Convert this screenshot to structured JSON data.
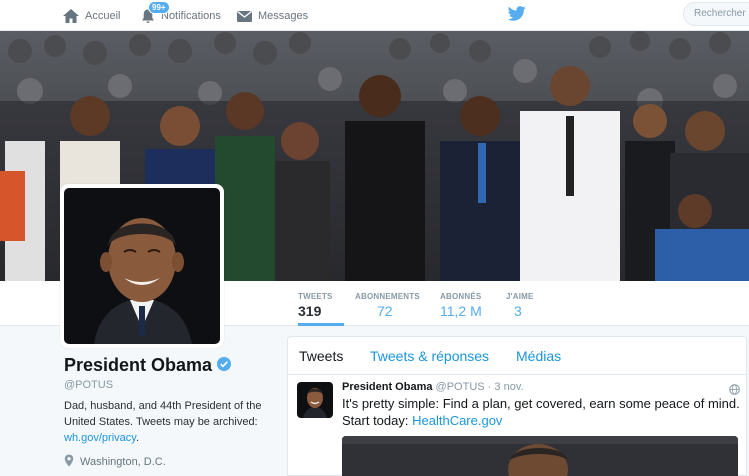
{
  "nav": {
    "home_label": "Accueil",
    "notifications_label": "Notifications",
    "notifications_badge": "99+",
    "messages_label": "Messages",
    "search_placeholder": "Rechercher sur Twitter"
  },
  "stats": [
    {
      "label": "TWEETS",
      "value": "319"
    },
    {
      "label": "ABONNEMENTS",
      "value": "72"
    },
    {
      "label": "ABONNÉS",
      "value": "11,2 M"
    },
    {
      "label": "J'AIME",
      "value": "3"
    }
  ],
  "profile": {
    "name": "President Obama",
    "handle": "@POTUS",
    "bio_text": "Dad, husband, and 44th President of the United States. Tweets may be archived:",
    "bio_link": "wh.gov/privacy",
    "bio_end": ".",
    "location": "Washington, D.C.",
    "verified": true
  },
  "timeline": {
    "tabs": [
      "Tweets",
      "Tweets & réponses",
      "Médias"
    ],
    "active_tab": "Tweets",
    "tweet": {
      "author": "President Obama",
      "handle": "@POTUS",
      "separator": "·",
      "date": "3 nov.",
      "text": "It's pretty simple: Find a plan, get covered, earn some peace of mind. Start today:",
      "link": "HealthCare.gov"
    }
  },
  "colors": {
    "accent": "#55acee",
    "link": "#1b95e0",
    "background": "#f5f8fa"
  },
  "icons": [
    "home-icon",
    "bell-icon",
    "envelope-icon",
    "twitter-bird-icon",
    "verified-badge-icon",
    "location-pin-icon",
    "globe-icon"
  ]
}
